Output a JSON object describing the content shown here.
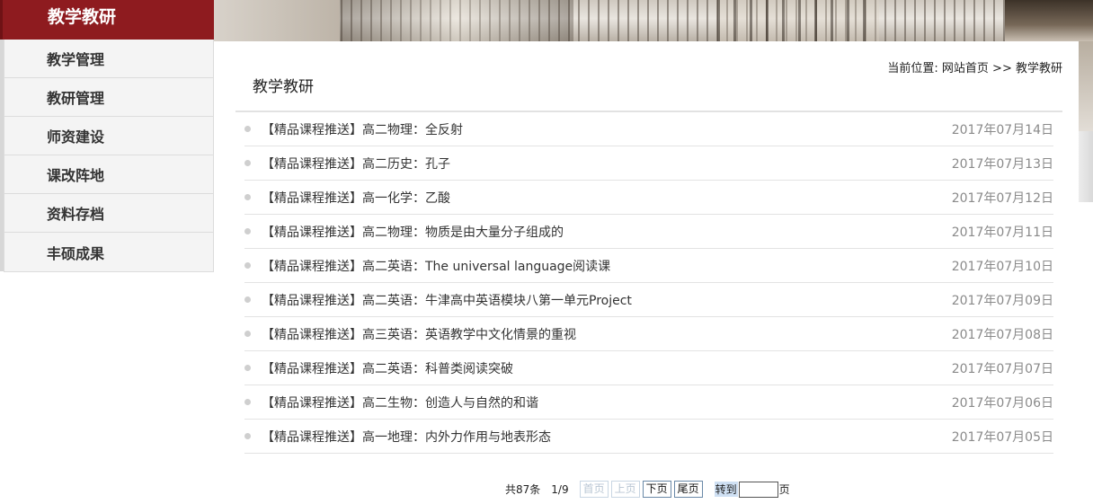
{
  "sidebar": {
    "title": "教学教研",
    "items": [
      {
        "label": "教学管理"
      },
      {
        "label": "教研管理"
      },
      {
        "label": "师资建设"
      },
      {
        "label": "课改阵地"
      },
      {
        "label": "资料存档"
      },
      {
        "label": "丰硕成果"
      }
    ]
  },
  "main": {
    "title": "教学教研",
    "breadcrumb": {
      "prefix": "当前位置:",
      "home": "网站首页",
      "sep": ">>",
      "current": "教学教研"
    },
    "articles": [
      {
        "title": "【精品课程推送】高二物理：全反射",
        "date": "2017年07月14日"
      },
      {
        "title": "【精品课程推送】高二历史：孔子",
        "date": "2017年07月13日"
      },
      {
        "title": "【精品课程推送】高一化学：乙酸",
        "date": "2017年07月12日"
      },
      {
        "title": "【精品课程推送】高二物理：物质是由大量分子组成的",
        "date": "2017年07月11日"
      },
      {
        "title": "【精品课程推送】高二英语：The universal language阅读课",
        "date": "2017年07月10日"
      },
      {
        "title": "【精品课程推送】高二英语：牛津高中英语模块八第一单元Project",
        "date": "2017年07月09日"
      },
      {
        "title": "【精品课程推送】高三英语：英语教学中文化情景的重视",
        "date": "2017年07月08日"
      },
      {
        "title": "【精品课程推送】高二英语：科普类阅读突破",
        "date": "2017年07月07日"
      },
      {
        "title": "【精品课程推送】高二生物：创造人与自然的和谐",
        "date": "2017年07月06日"
      },
      {
        "title": "【精品课程推送】高一地理：内外力作用与地表形态",
        "date": "2017年07月05日"
      }
    ]
  },
  "pager": {
    "total": "共87条",
    "page": "1/9",
    "first": "首页",
    "prev": "上页",
    "next": "下页",
    "last": "尾页",
    "goto": "转到",
    "goto_value": "",
    "unit": "页"
  },
  "colors": {
    "sidebar_head": "#8e1b1f",
    "date_text": "#8a8a8a"
  }
}
